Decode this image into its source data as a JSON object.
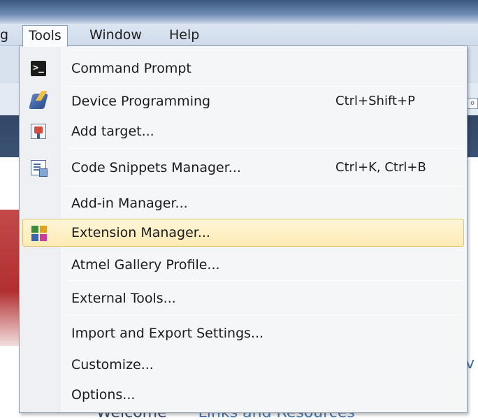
{
  "menubar": {
    "cut_label": "g",
    "tools_label": "Tools",
    "window_label": "Window",
    "help_label": "Help"
  },
  "background": {
    "right_partial_text": "v",
    "welcome_tab": "Welcome",
    "links_tab": "Links and Resources",
    "mini_box_text": "o"
  },
  "tools_menu": {
    "items": [
      {
        "label": "Command Prompt",
        "shortcut": "",
        "icon": "command-prompt-icon"
      },
      {
        "label": "Device Programming",
        "shortcut": "Ctrl+Shift+P",
        "icon": "device-programming-icon"
      },
      {
        "label": "Add target...",
        "shortcut": "",
        "icon": "add-target-icon"
      },
      {
        "label": "Code Snippets Manager...",
        "shortcut": "Ctrl+K, Ctrl+B",
        "icon": "code-snippets-icon"
      },
      {
        "label": "Add-in Manager...",
        "shortcut": "",
        "icon": ""
      },
      {
        "label": "Extension Manager...",
        "shortcut": "",
        "icon": "extension-manager-icon",
        "highlighted": true
      },
      {
        "label": "Atmel Gallery Profile...",
        "shortcut": "",
        "icon": ""
      },
      {
        "label": "External Tools...",
        "shortcut": "",
        "icon": ""
      },
      {
        "label": "Import and Export Settings...",
        "shortcut": "",
        "icon": ""
      },
      {
        "label": "Customize...",
        "shortcut": "",
        "icon": ""
      },
      {
        "label": "Options...",
        "shortcut": "",
        "icon": ""
      }
    ]
  },
  "colors": {
    "highlight": "#fdebb4",
    "highlight_border": "#e5c365",
    "menu_background": "#f5f6f8"
  }
}
